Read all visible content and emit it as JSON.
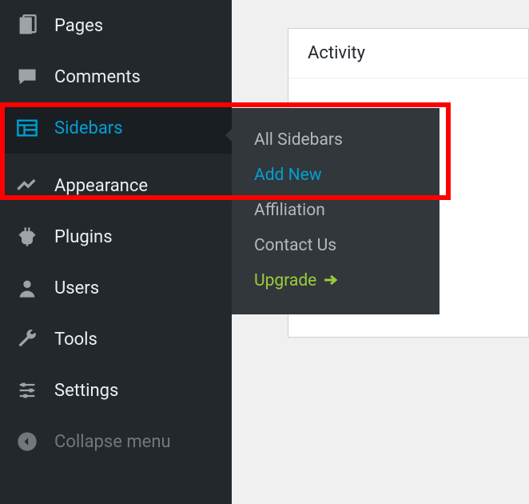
{
  "sidebar": {
    "items": [
      {
        "id": "pages",
        "label": "Pages"
      },
      {
        "id": "comments",
        "label": "Comments"
      },
      {
        "id": "sidebars",
        "label": "Sidebars",
        "active": true
      },
      {
        "id": "appearance",
        "label": "Appearance"
      },
      {
        "id": "plugins",
        "label": "Plugins"
      },
      {
        "id": "users",
        "label": "Users"
      },
      {
        "id": "tools",
        "label": "Tools"
      },
      {
        "id": "settings",
        "label": "Settings"
      }
    ],
    "collapse_label": "Collapse menu"
  },
  "submenu": {
    "items": [
      {
        "label": "All Sidebars"
      },
      {
        "label": "Add New",
        "highlight": true
      },
      {
        "label": "Affiliation"
      },
      {
        "label": "Contact Us"
      },
      {
        "label": "Upgrade",
        "upgrade": true
      }
    ]
  },
  "content": {
    "panel_title": "Activity"
  },
  "colors": {
    "accent": "#00a0d2",
    "upgrade": "#9ccc3c",
    "sidebar_bg": "#23282d",
    "submenu_bg": "#32373c",
    "highlight_border": "#ff0000"
  }
}
